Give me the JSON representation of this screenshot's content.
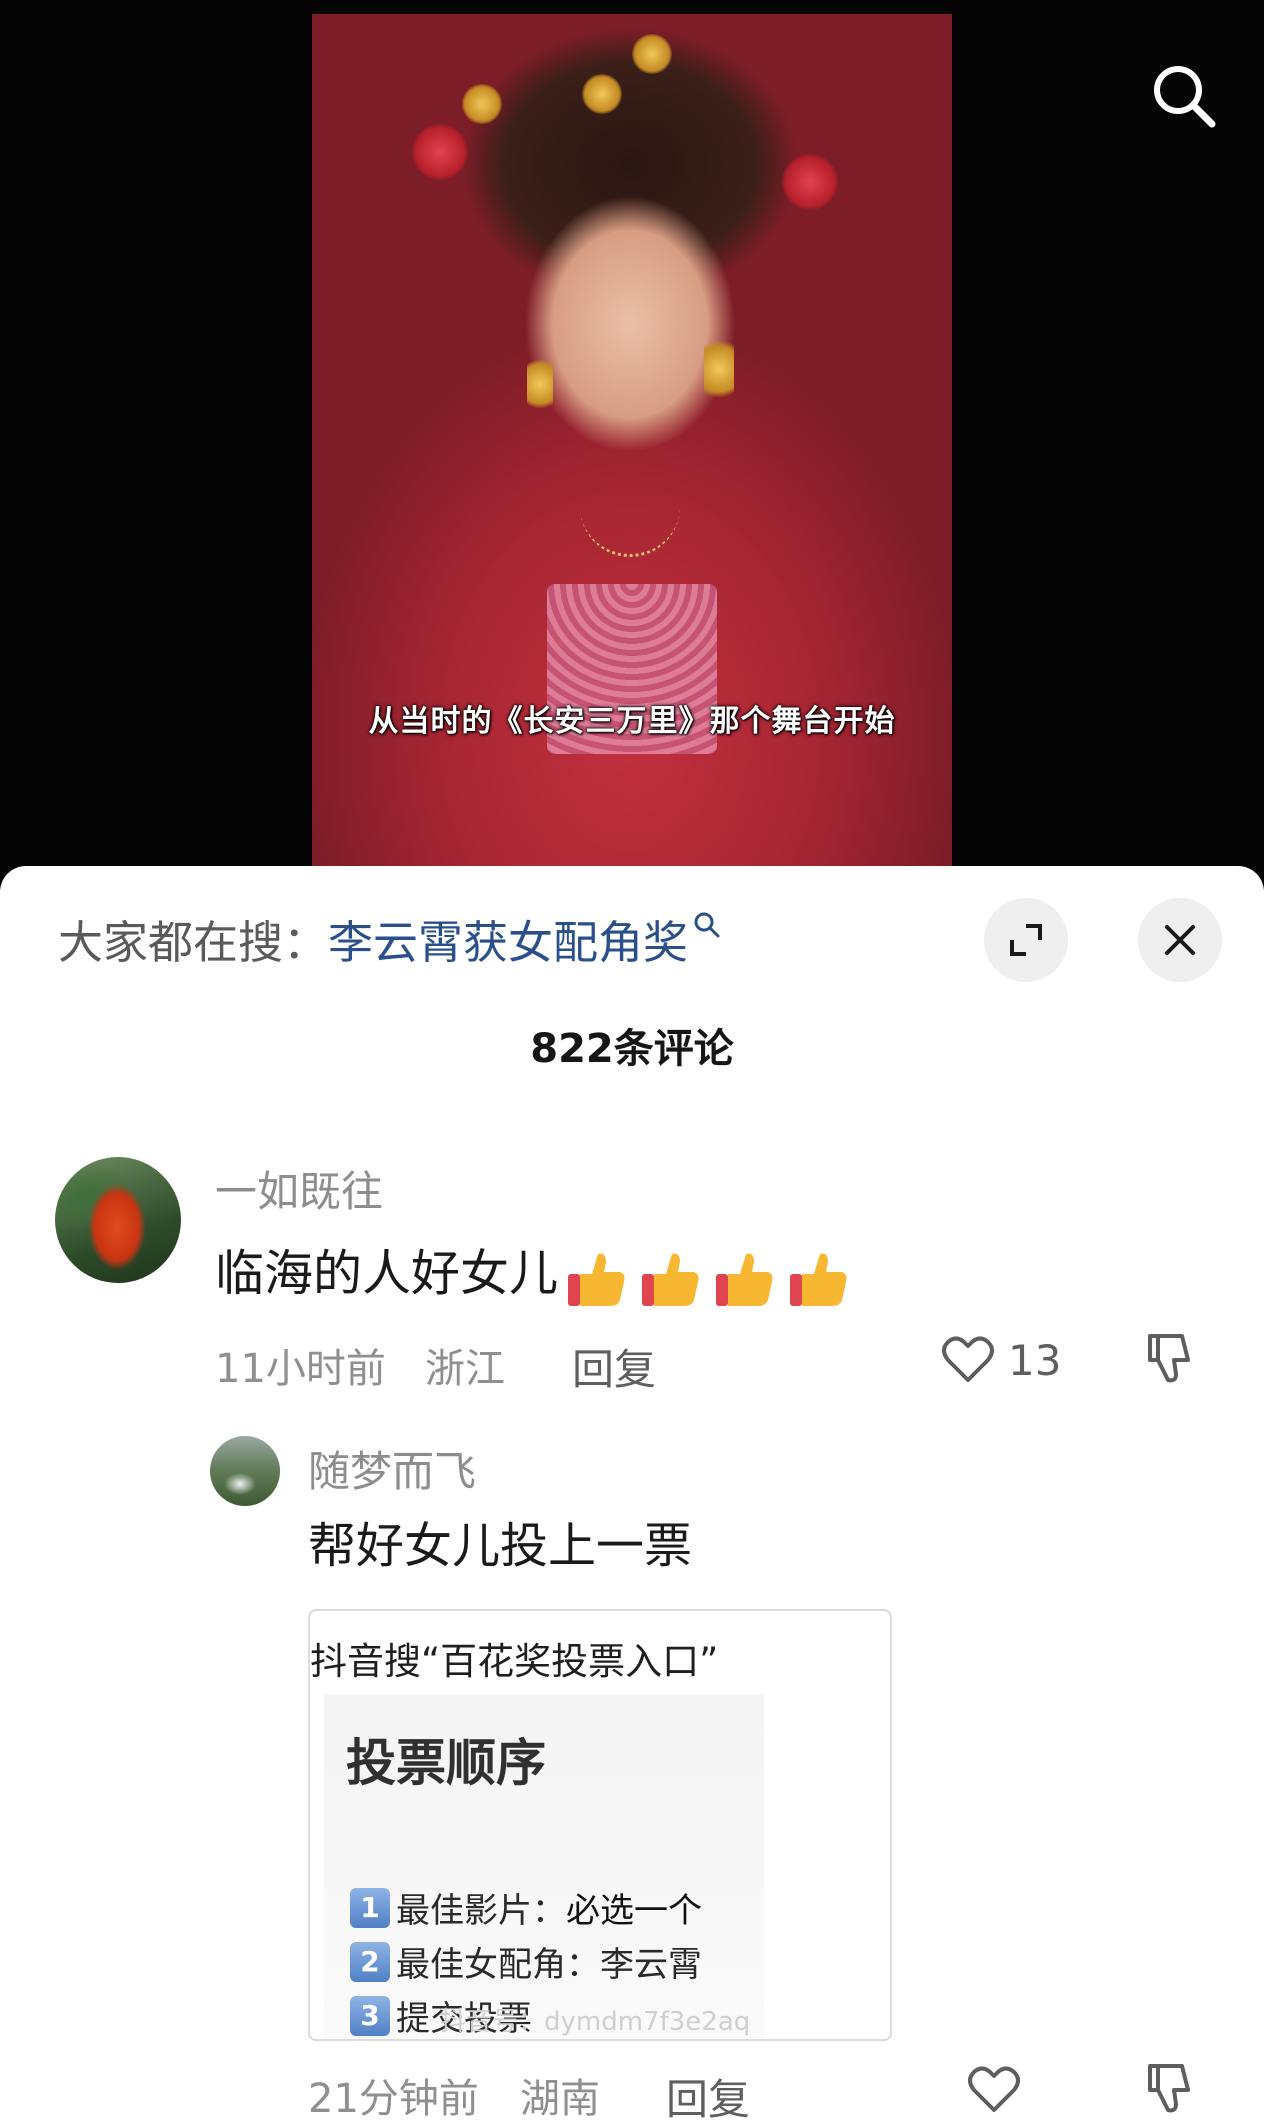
{
  "video": {
    "subtitle": "从当时的《长安三万里》那个舞台开始"
  },
  "header": {
    "trending_prefix": "大家都在搜：",
    "trending_query": "李云霄获女配角奖",
    "comment_count": "822条评论"
  },
  "comments": [
    {
      "username": "一如既往",
      "text": "临海的人好女儿",
      "time": "11小时前",
      "location": "浙江",
      "reply_label": "回复",
      "likes": "13"
    }
  ],
  "replies": [
    {
      "username": "随梦而飞",
      "text": "帮好女儿投上一票",
      "time": "21分钟前",
      "location": "湖南",
      "reply_label": "回复",
      "image": {
        "caption": "抖音搜“百花奖投票入口”",
        "heading": "投票顺序",
        "steps": [
          {
            "num": "1",
            "label": "最佳影片：",
            "value": "必选一个"
          },
          {
            "num": "2",
            "label": "最佳女配角：",
            "value": "李云霄"
          },
          {
            "num": "3",
            "label": "提交投票",
            "value": ""
          }
        ],
        "watermark": "抖音号：dymdm7f3e2aq"
      }
    }
  ],
  "icons": {
    "search": "search-icon",
    "expand": "expand-icon",
    "close": "close-icon",
    "like": "heart-icon",
    "dislike": "thumbs-down-icon",
    "emoji": "thumbs-up-emoji"
  },
  "colors": {
    "link": "#2a4f8a",
    "muted": "#8f8f8f",
    "sheet_bg": "#ffffff"
  }
}
